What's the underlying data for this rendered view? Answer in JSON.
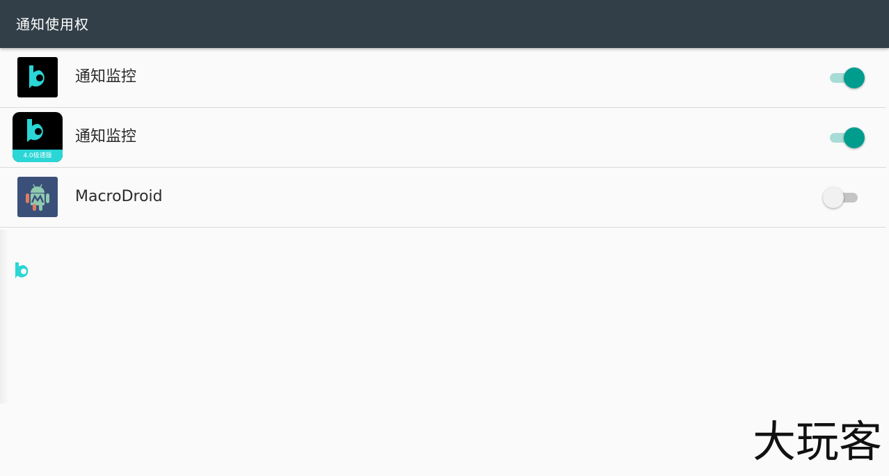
{
  "header": {
    "title": "通知使用权",
    "background_color": "#333f48"
  },
  "apps": [
    {
      "label": "通知监控",
      "icon": "bilibili-b-logo-icon",
      "enabled": true
    },
    {
      "label": "通知监控",
      "icon": "bilibili-b-logo-speed-edition-icon",
      "badge": "4.0极速版",
      "enabled": true
    },
    {
      "label": "MacroDroid",
      "icon": "macrodroid-android-icon",
      "enabled": false
    }
  ],
  "colors": {
    "accent": "#009d8f",
    "accent_track": "#a8dcd6",
    "logo_cyan": "#2ad6d6"
  },
  "watermark": "大玩客"
}
